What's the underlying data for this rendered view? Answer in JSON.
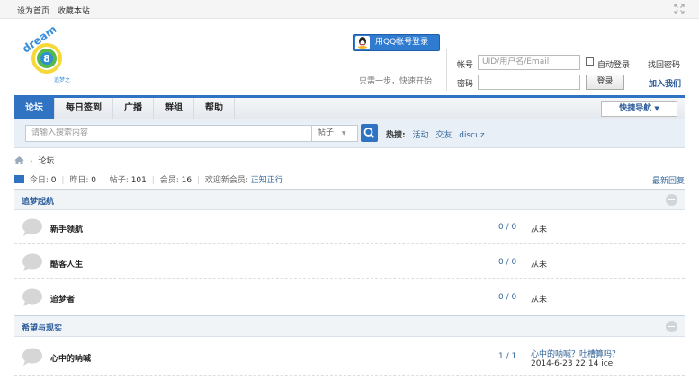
{
  "topbar": {
    "set_home": "设为首页",
    "bookmark": "收藏本站"
  },
  "logo": {
    "text_top": "dream",
    "text_num": "8",
    "text_bottom": "追梦之"
  },
  "qq_login": {
    "label": "用QQ帐号登录",
    "hint": "只需一步，快速开始"
  },
  "login": {
    "account_label": "帐号",
    "account_placeholder": "UID/用户名/Email",
    "password_label": "密码",
    "auto_login": "自动登录",
    "login_button": "登录",
    "find_password": "找回密码",
    "join": "加入我们"
  },
  "nav": {
    "items": [
      "论坛",
      "每日签到",
      "广播",
      "群组",
      "帮助"
    ],
    "quick_nav": "快捷导航"
  },
  "search": {
    "placeholder": "请输入搜索内容",
    "type": "帖子",
    "hot_label": "热搜:",
    "hot": [
      "活动",
      "交友",
      "discuz"
    ]
  },
  "breadcrumb": {
    "current": "论坛"
  },
  "stats": {
    "today_label": "今日:",
    "today": "0",
    "yesterday_label": "昨日:",
    "yesterday": "0",
    "posts_label": "帖子:",
    "posts": "101",
    "members_label": "会员:",
    "members": "16",
    "welcome_label": "欢迎新会员:",
    "new_member": "正知正行",
    "latest": "最新回复"
  },
  "sections": [
    {
      "title": "追梦起航",
      "forums": [
        {
          "name": "新手领航",
          "count": "0 / 0",
          "last": "从未"
        },
        {
          "name": "酷客人生",
          "count": "0 / 0",
          "last": "从未"
        },
        {
          "name": "追梦者",
          "count": "0 / 0",
          "last": "从未"
        }
      ]
    },
    {
      "title": "希望与现实",
      "forums": [
        {
          "name": "心中的呐喊",
          "count": "1 / 1",
          "last_title": "心中的呐喊？吐槽算吗？",
          "last_info": "2014-6-23 22:14 ice"
        }
      ]
    }
  ],
  "colors": {
    "accent": "#2f73c2",
    "link": "#336699"
  }
}
